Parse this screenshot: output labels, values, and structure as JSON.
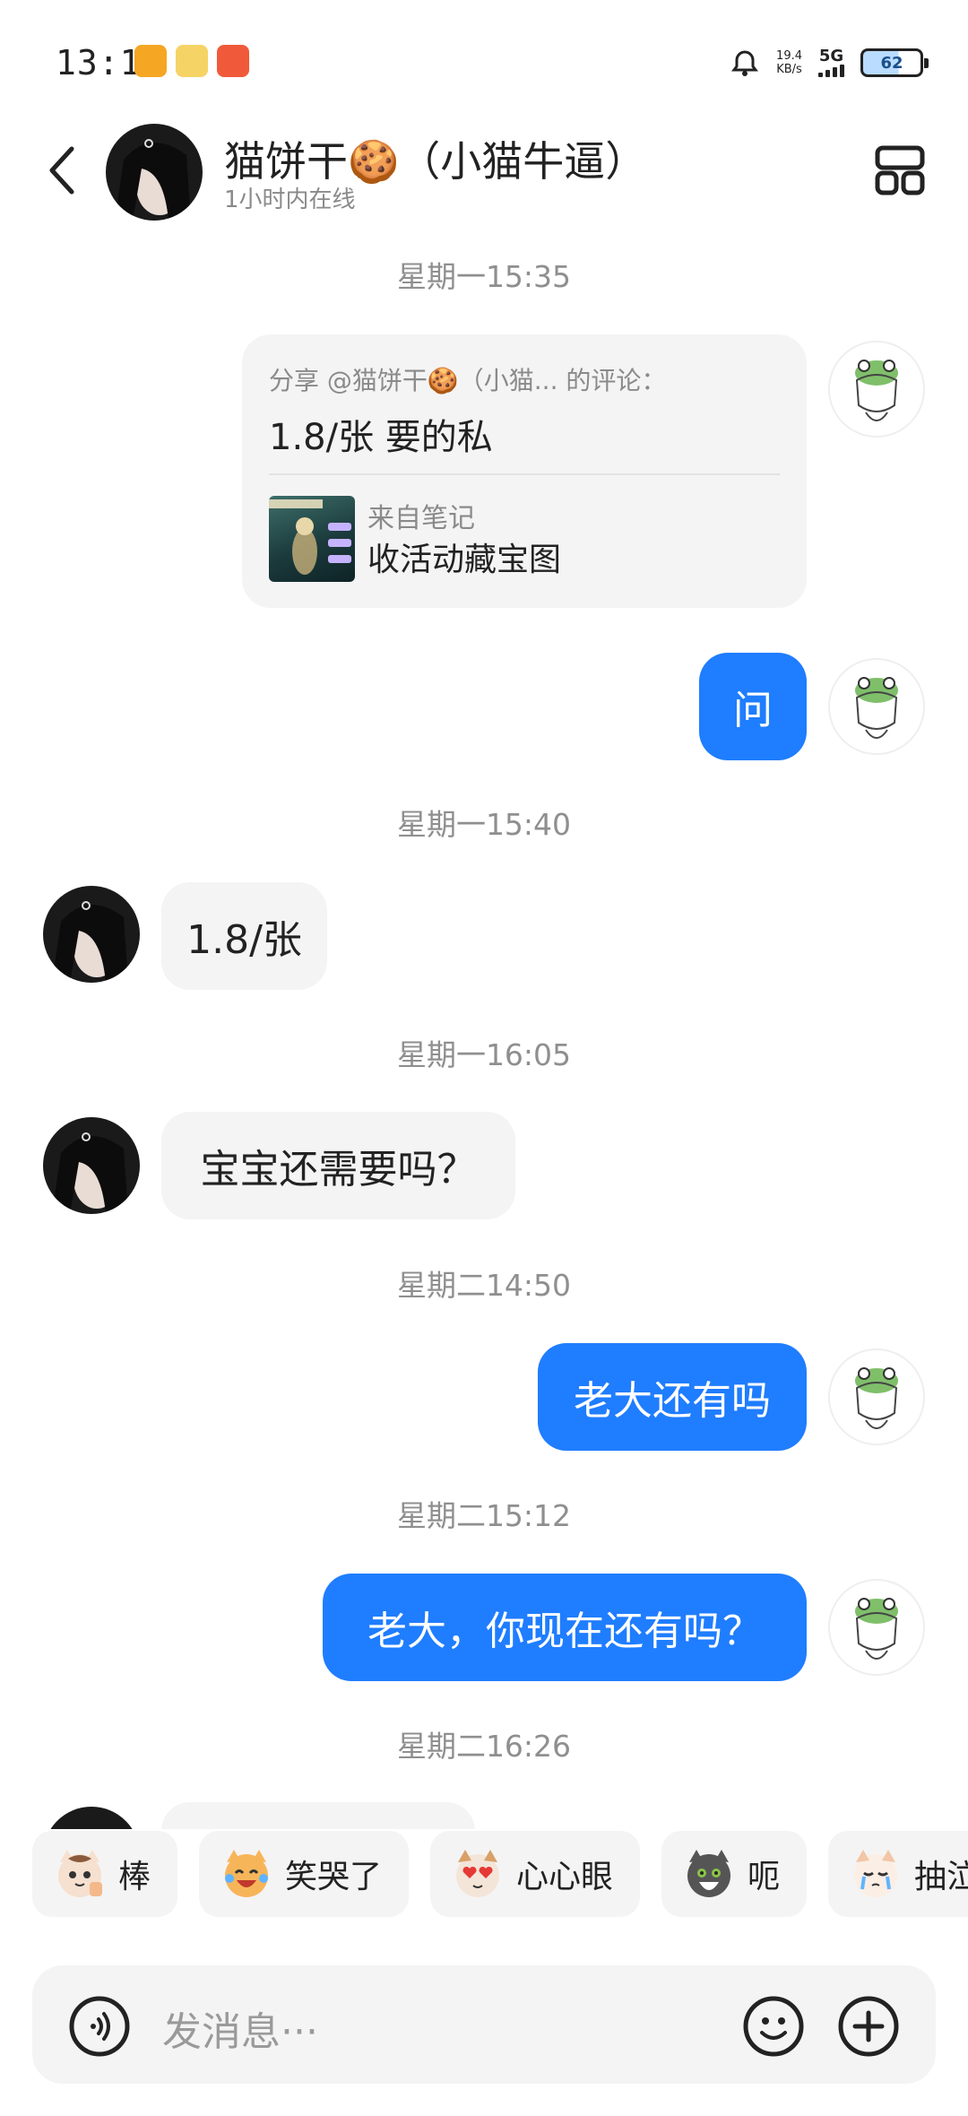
{
  "status_bar": {
    "time": "13:11",
    "net_speed_value": "19.4",
    "net_speed_unit": "KB/s",
    "network": "5G",
    "battery": "62"
  },
  "header": {
    "name": "猫饼干🍪（小猫牛逼）",
    "status": "1小时内在线"
  },
  "messages": {
    "ts1": "星期一15:35",
    "share_title": "分享 @猫饼干🍪（小猫... 的评论：",
    "share_text": "1.8/张 要的私",
    "share_source": "来自笔记",
    "share_note": "收活动藏宝图",
    "msg_ask": "问",
    "ts2": "星期一15:40",
    "msg_price": "1.8/张",
    "ts3": "星期一16:05",
    "msg_need": "宝宝还需要吗？",
    "ts4": "星期二14:50",
    "msg_boss1": "老大还有吗",
    "ts5": "星期二15:12",
    "msg_boss2": "老大，你现在还有吗？",
    "ts6": "星期二16:26"
  },
  "reactions": [
    {
      "label": "棒",
      "icon": "cat-thumbs-up-icon"
    },
    {
      "label": "笑哭了",
      "icon": "cat-laugh-cry-icon"
    },
    {
      "label": "心心眼",
      "icon": "cat-heart-eyes-icon"
    },
    {
      "label": "呃",
      "icon": "cat-speechless-icon"
    },
    {
      "label": "抽泣",
      "icon": "cat-sob-icon"
    }
  ],
  "input": {
    "placeholder": "发消息···"
  },
  "colors": {
    "accent": "#1f7dff",
    "bubble_grey": "#f4f4f4",
    "timestamp": "#8f8f8f"
  }
}
